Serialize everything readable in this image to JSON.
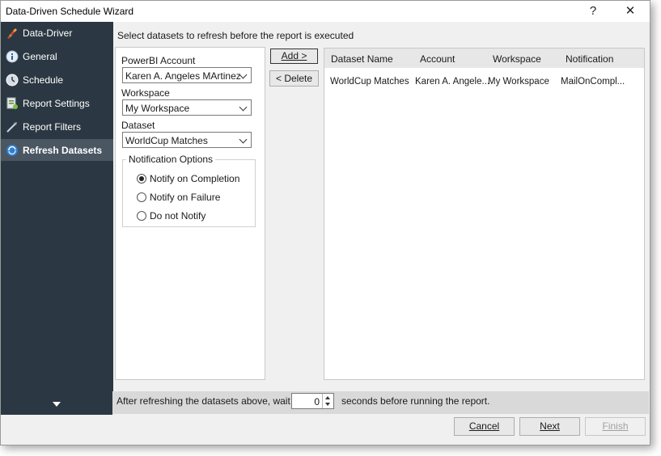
{
  "window": {
    "title": "Data-Driven Schedule Wizard",
    "help_label": "?",
    "close_label": "✕"
  },
  "sidebar": {
    "items": [
      {
        "label": "Data-Driver",
        "icon": "data-driver-icon",
        "active": false
      },
      {
        "label": "General",
        "icon": "info-icon",
        "active": false
      },
      {
        "label": "Schedule",
        "icon": "clock-icon",
        "active": false
      },
      {
        "label": "Report Settings",
        "icon": "report-settings-icon",
        "active": false
      },
      {
        "label": "Report Filters",
        "icon": "filter-icon",
        "active": false
      },
      {
        "label": "Refresh Datasets",
        "icon": "refresh-datasets-icon",
        "active": true
      }
    ]
  },
  "main": {
    "instruction": "Select datasets to refresh before the report is executed",
    "account_label": "PowerBI Account",
    "account_value": "Karen A. Angeles MArtinez",
    "workspace_label": "Workspace",
    "workspace_value": "My Workspace",
    "dataset_label": "Dataset",
    "dataset_value": "WorldCup Matches",
    "notification": {
      "legend": "Notification Options",
      "options": [
        {
          "label": "Notify on Completion",
          "selected": true
        },
        {
          "label": "Notify on Failure",
          "selected": false
        },
        {
          "label": "Do not Notify",
          "selected": false
        }
      ]
    },
    "add_label": "Add >",
    "delete_label": "< Delete"
  },
  "table": {
    "columns": [
      "Dataset Name",
      "Account",
      "Workspace",
      "Notification"
    ],
    "rows": [
      [
        "WorldCup Matches",
        "Karen A. Angele...",
        "My Workspace",
        "MailOnCompl..."
      ]
    ]
  },
  "wait": {
    "before": "After refreshing the datasets above, wait",
    "seconds": "0",
    "after": "seconds before running the report."
  },
  "footer": {
    "cancel": "Cancel",
    "next": "Next",
    "finish": "Finish"
  },
  "colors": {
    "sidebar_bg": "#2b3843",
    "sidebar_active": "#4a5763",
    "accent_icon": "#1e73be"
  }
}
